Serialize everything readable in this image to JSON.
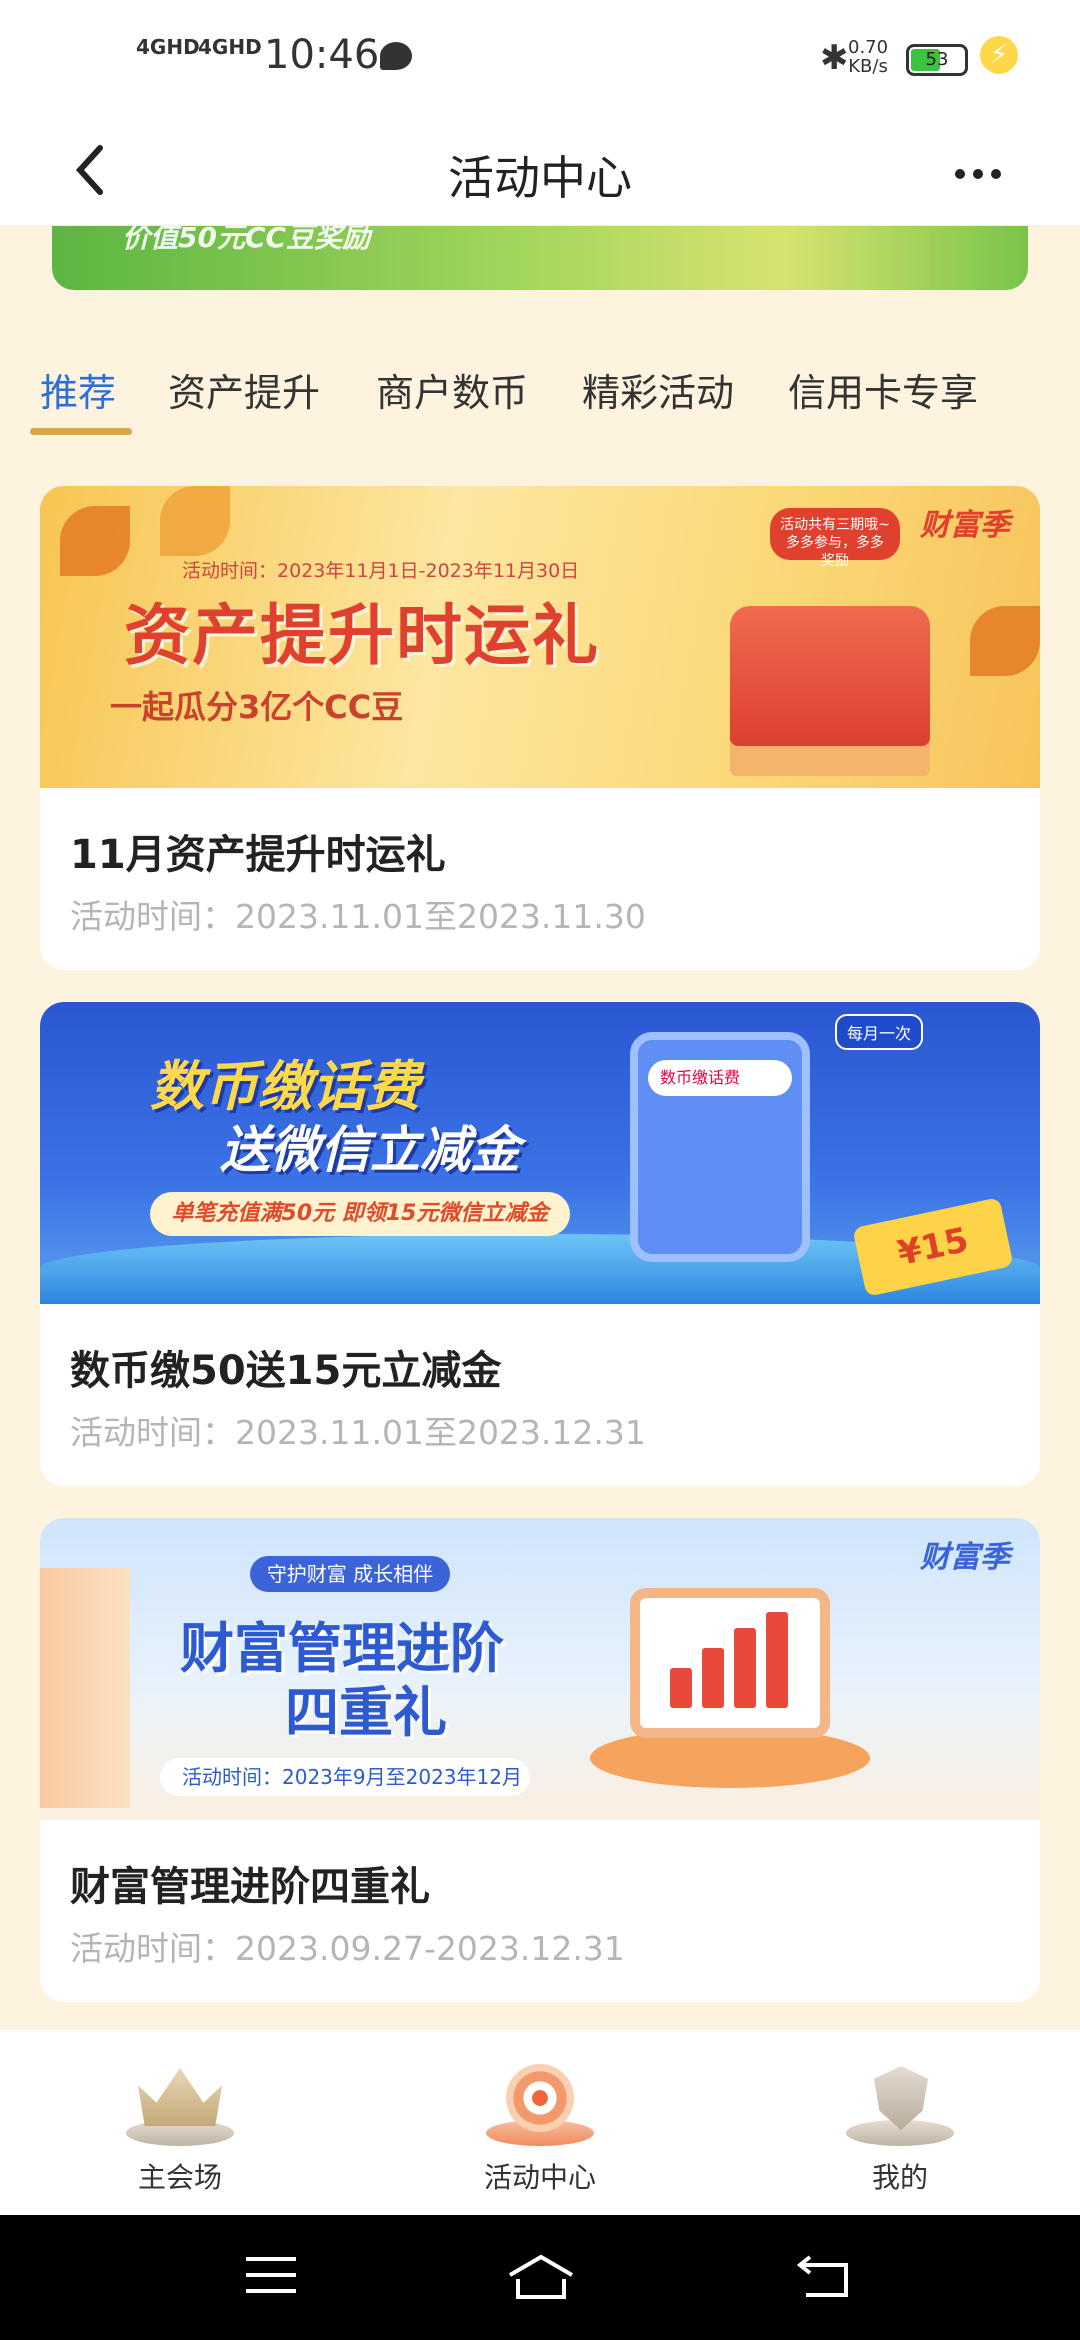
{
  "status": {
    "sig1": "4GHD",
    "sig2": "4GHD",
    "time": "10:46",
    "speed_value": "0.70",
    "speed_unit": "KB/s",
    "battery": "53"
  },
  "nav": {
    "title": "活动中心",
    "back_icon": "chevron-left-icon",
    "more_icon": "more-dots-icon"
  },
  "top_banner": {
    "text": "价值50元CC豆奖励"
  },
  "tabs": [
    "推荐",
    "资产提升",
    "商户数币",
    "精彩活动",
    "信用卡专享"
  ],
  "active_tab_index": 0,
  "cards": [
    {
      "banner": {
        "time": "活动时间：2023年11月1日-2023年11月30日",
        "headline": "资产提升时运礼",
        "sub": "一起瓜分3亿个CC豆",
        "tag": "活动共有三期哦~多多参与，多多奖励",
        "logo": "财富季"
      },
      "title": "11月资产提升时运礼",
      "date": "活动时间：2023.11.01至2023.11.30"
    },
    {
      "banner": {
        "headline1": "数币缴话费",
        "headline2": "送微信立减金",
        "strip": "单笔充值满50元 即领15元微信立减金",
        "search": "数币缴话费",
        "tag": "每月一次",
        "coupon": "¥15"
      },
      "title": "数币缴50送15元立减金",
      "date": "活动时间：2023.11.01至2023.12.31"
    },
    {
      "banner": {
        "top": "守护财富 成长相伴",
        "headline1": "财富管理进阶",
        "headline2": "四重礼",
        "time": "活动时间：2023年9月至2023年12月",
        "logo": "财富季"
      },
      "title": "财富管理进阶四重礼",
      "date": "活动时间：2023.09.27-2023.12.31"
    }
  ],
  "bottom_nav": [
    {
      "label": "主会场",
      "icon": "crown-icon"
    },
    {
      "label": "活动中心",
      "icon": "target-icon"
    },
    {
      "label": "我的",
      "icon": "shield-icon"
    }
  ],
  "colors": {
    "accent": "#2c6fd6",
    "underline": "#d7a64a",
    "background": "#fdf3de"
  }
}
